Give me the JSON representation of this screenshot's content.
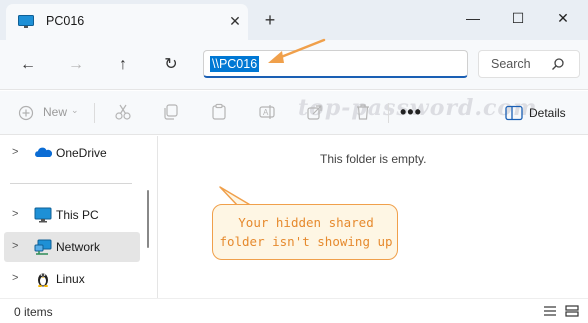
{
  "window": {
    "tab_title": "PC016",
    "close_tab": "✕",
    "new_tab": "+",
    "minimize": "—",
    "maximize": "☐",
    "close": "✕"
  },
  "nav": {
    "back": "←",
    "forward": "→",
    "up": "↑",
    "refresh": "↻",
    "address_value": "\\\\PC016",
    "search_placeholder": "Search"
  },
  "toolbar": {
    "new_label": "New",
    "more_label": "•••",
    "details_label": "Details",
    "watermark": "top-password.com"
  },
  "sidebar": {
    "items": [
      {
        "label": "OneDrive",
        "icon": "onedrive-icon"
      },
      {
        "label": "This PC",
        "icon": "monitor-icon"
      },
      {
        "label": "Network",
        "icon": "network-icon",
        "selected": true
      },
      {
        "label": "Linux",
        "icon": "linux-penguin-icon"
      }
    ]
  },
  "content": {
    "empty_message": "This folder is empty."
  },
  "callout": {
    "line1": "Your hidden shared",
    "line2": "folder isn't showing up"
  },
  "status": {
    "item_count": "0 items"
  },
  "colors": {
    "accent": "#0078d4",
    "callout_border": "#f0a04b",
    "callout_text": "#e68a2e",
    "callout_fill": "#fef6e4"
  }
}
